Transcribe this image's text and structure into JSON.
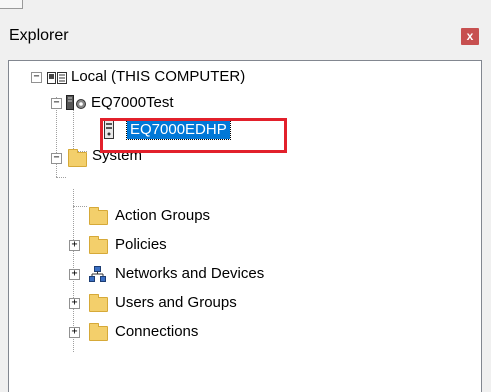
{
  "panel": {
    "title": "Explorer",
    "close_glyph": "x"
  },
  "tree": {
    "local": {
      "label": "Local (THIS COMPUTER)",
      "expander": "−",
      "icon": "computer-icon"
    },
    "eq7000test": {
      "label": "EQ7000Test",
      "expander": "−",
      "icon": "server-gear-icon"
    },
    "eq7000edhp": {
      "label": "EQ7000EDHP",
      "icon": "device-icon",
      "selected": true
    },
    "system": {
      "label": "System",
      "expander": "−",
      "icon": "folder-icon"
    },
    "children": [
      {
        "label": "Action Groups",
        "icon": "folder-icon",
        "expander": ""
      },
      {
        "label": "Policies",
        "icon": "folder-icon",
        "expander": "+"
      },
      {
        "label": "Networks and Devices",
        "icon": "network-icon",
        "expander": "+"
      },
      {
        "label": "Users and Groups",
        "icon": "folder-icon",
        "expander": "+"
      },
      {
        "label": "Connections",
        "icon": "folder-icon",
        "expander": "+"
      }
    ]
  },
  "colors": {
    "selection": "#0078d7",
    "highlight_box": "#e2202b",
    "close_button": "#c75050",
    "folder": "#f3cf6b"
  }
}
